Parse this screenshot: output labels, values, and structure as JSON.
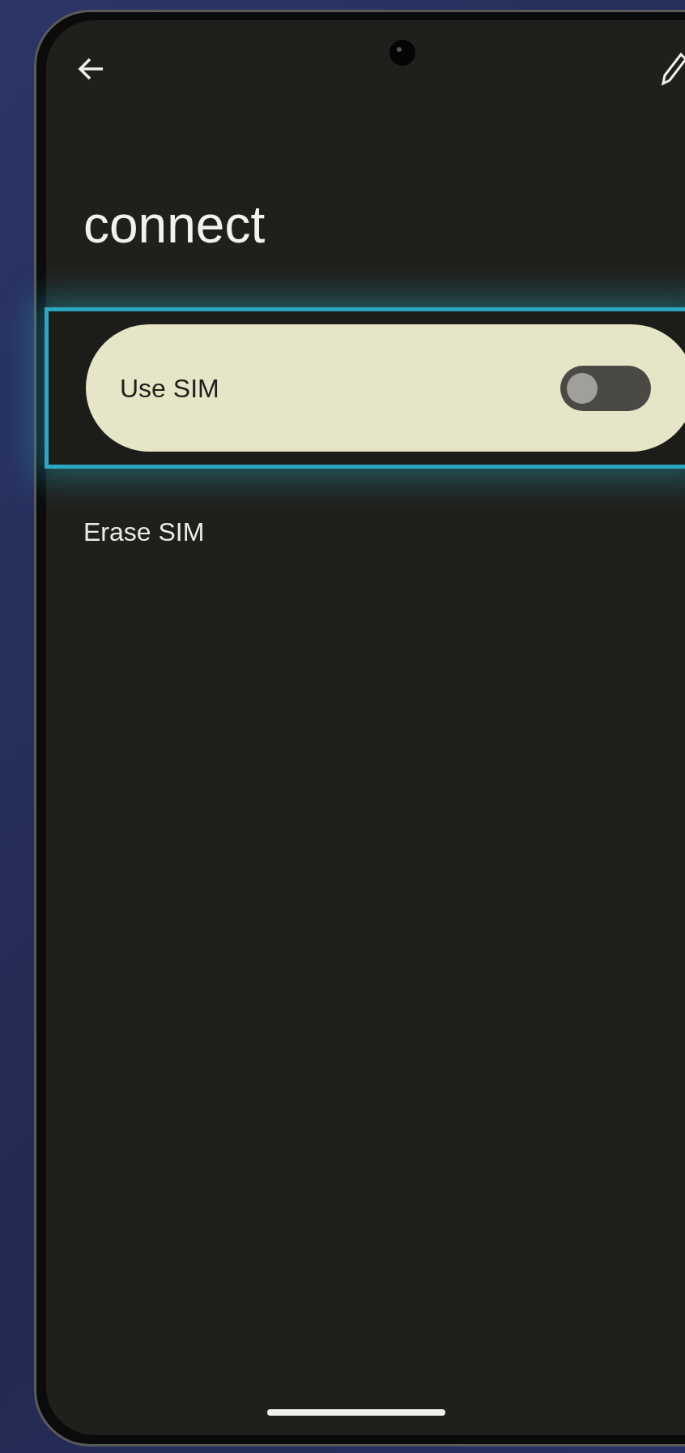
{
  "title": "connect",
  "settings": [
    {
      "kind": "toggle",
      "label": "Use SIM",
      "checked": false,
      "highlighted": true
    },
    {
      "kind": "action",
      "label": "Erase SIM",
      "highlighted": false
    }
  ]
}
